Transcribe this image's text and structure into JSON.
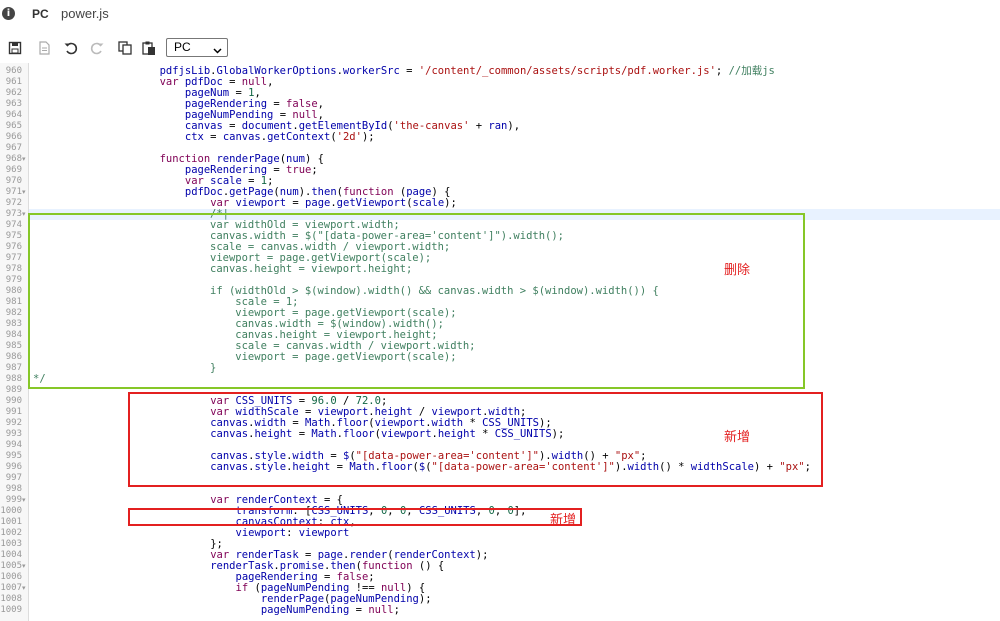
{
  "titlebar": {
    "info_icon": "info-icon",
    "badge": "PC",
    "filename": "power.js"
  },
  "toolbar": {
    "select_value": "PC",
    "icons": [
      "save-icon",
      "file-icon",
      "undo-icon",
      "redo-icon",
      "copy-icon",
      "paste-icon"
    ]
  },
  "annotations": {
    "delete_label": "删除",
    "add_label_1": "新增",
    "add_label_2": "新增",
    "colors": {
      "delete_box": "#86c728",
      "add_box": "#e32020",
      "label": "#e32020"
    }
  },
  "editor": {
    "highlight_line": "973",
    "lines": [
      {
        "n": "960",
        "f": "",
        "t": "                    pdfjsLib.GlobalWorkerOptions.workerSrc = '/content/_common/assets/scripts/pdf.worker.js'; //加载js"
      },
      {
        "n": "961",
        "f": "",
        "t": "                    var pdfDoc = null,"
      },
      {
        "n": "962",
        "f": "",
        "t": "                        pageNum = 1,"
      },
      {
        "n": "963",
        "f": "",
        "t": "                        pageRendering = false,"
      },
      {
        "n": "964",
        "f": "",
        "t": "                        pageNumPending = null,"
      },
      {
        "n": "965",
        "f": "",
        "t": "                        canvas = document.getElementById('the-canvas' + ran),"
      },
      {
        "n": "966",
        "f": "",
        "t": "                        ctx = canvas.getContext('2d');"
      },
      {
        "n": "967",
        "f": "",
        "t": ""
      },
      {
        "n": "968",
        "f": "▾",
        "t": "                    function renderPage(num) {"
      },
      {
        "n": "969",
        "f": "",
        "t": "                        pageRendering = true;"
      },
      {
        "n": "970",
        "f": "",
        "t": "                        var scale = 1;"
      },
      {
        "n": "971",
        "f": "▾",
        "t": "                        pdfDoc.getPage(num).then(function (page) {"
      },
      {
        "n": "972",
        "f": "",
        "t": "                            var viewport = page.getViewport(scale);"
      },
      {
        "n": "973",
        "f": "▾",
        "t": "                            /*|"
      },
      {
        "n": "974",
        "f": "",
        "t": "                            var widthOld = viewport.width;"
      },
      {
        "n": "975",
        "f": "",
        "t": "                            canvas.width = $(\"[data-power-area='content']\").width();"
      },
      {
        "n": "976",
        "f": "",
        "t": "                            scale = canvas.width / viewport.width;"
      },
      {
        "n": "977",
        "f": "",
        "t": "                            viewport = page.getViewport(scale);"
      },
      {
        "n": "978",
        "f": "",
        "t": "                            canvas.height = viewport.height;"
      },
      {
        "n": "979",
        "f": "",
        "t": ""
      },
      {
        "n": "980",
        "f": "",
        "t": "                            if (widthOld > $(window).width() && canvas.width > $(window).width()) {"
      },
      {
        "n": "981",
        "f": "",
        "t": "                                scale = 1;"
      },
      {
        "n": "982",
        "f": "",
        "t": "                                viewport = page.getViewport(scale);"
      },
      {
        "n": "983",
        "f": "",
        "t": "                                canvas.width = $(window).width();"
      },
      {
        "n": "984",
        "f": "",
        "t": "                                canvas.height = viewport.height;"
      },
      {
        "n": "985",
        "f": "",
        "t": "                                scale = canvas.width / viewport.width;"
      },
      {
        "n": "986",
        "f": "",
        "t": "                                viewport = page.getViewport(scale);"
      },
      {
        "n": "987",
        "f": "",
        "t": "                            }"
      },
      {
        "n": "988",
        "f": "",
        "t": "*/"
      },
      {
        "n": "989",
        "f": "",
        "t": ""
      },
      {
        "n": "990",
        "f": "",
        "t": "                            var CSS_UNITS = 96.0 / 72.0;"
      },
      {
        "n": "991",
        "f": "",
        "t": "                            var widthScale = viewport.height / viewport.width;"
      },
      {
        "n": "992",
        "f": "",
        "t": "                            canvas.width = Math.floor(viewport.width * CSS_UNITS);"
      },
      {
        "n": "993",
        "f": "",
        "t": "                            canvas.height = Math.floor(viewport.height * CSS_UNITS);"
      },
      {
        "n": "994",
        "f": "",
        "t": ""
      },
      {
        "n": "995",
        "f": "",
        "t": "                            canvas.style.width = $(\"[data-power-area='content']\").width() + \"px\";"
      },
      {
        "n": "996",
        "f": "",
        "t": "                            canvas.style.height = Math.floor($(\"[data-power-area='content']\").width() * widthScale) + \"px\";"
      },
      {
        "n": "997",
        "f": "",
        "t": ""
      },
      {
        "n": "998",
        "f": "",
        "t": ""
      },
      {
        "n": "999",
        "f": "▾",
        "t": "                            var renderContext = {"
      },
      {
        "n": "1000",
        "f": "",
        "t": "                                transform: [CSS_UNITS, 0, 0, CSS_UNITS, 0, 0],"
      },
      {
        "n": "1001",
        "f": "",
        "t": "                                canvasContext: ctx,"
      },
      {
        "n": "1002",
        "f": "",
        "t": "                                viewport: viewport"
      },
      {
        "n": "1003",
        "f": "",
        "t": "                            };"
      },
      {
        "n": "1004",
        "f": "",
        "t": "                            var renderTask = page.render(renderContext);"
      },
      {
        "n": "1005",
        "f": "▾",
        "t": "                            renderTask.promise.then(function () {"
      },
      {
        "n": "1006",
        "f": "",
        "t": "                                pageRendering = false;"
      },
      {
        "n": "1007",
        "f": "▾",
        "t": "                                if (pageNumPending !== null) {"
      },
      {
        "n": "1008",
        "f": "",
        "t": "                                    renderPage(pageNumPending);"
      },
      {
        "n": "1009",
        "f": "",
        "t": "                                    pageNumPending = null;"
      }
    ]
  }
}
